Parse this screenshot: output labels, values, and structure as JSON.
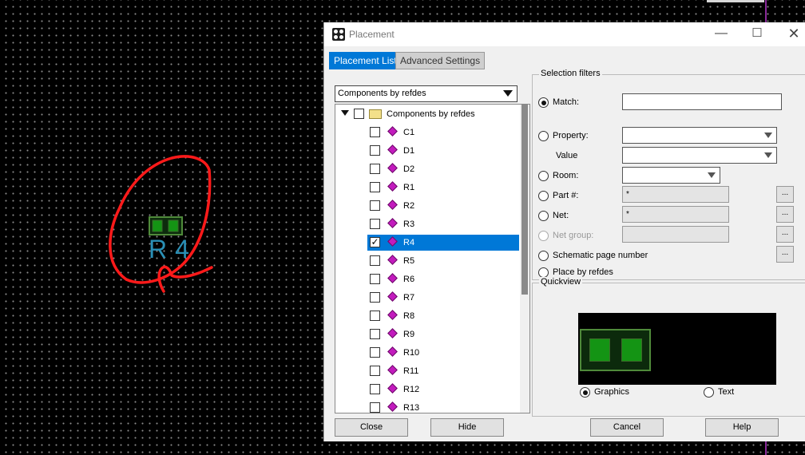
{
  "dialog": {
    "title": "Placement",
    "tabs": [
      {
        "label": "Placement List",
        "active": true
      },
      {
        "label": "Advanced Settings",
        "active": false
      }
    ],
    "list_mode": "Components by refdes",
    "tree": {
      "root_label": "Components by refdes",
      "items": [
        {
          "label": "C1",
          "checked": false,
          "selected": false
        },
        {
          "label": "D1",
          "checked": false,
          "selected": false
        },
        {
          "label": "D2",
          "checked": false,
          "selected": false
        },
        {
          "label": "R1",
          "checked": false,
          "selected": false
        },
        {
          "label": "R2",
          "checked": false,
          "selected": false
        },
        {
          "label": "R3",
          "checked": false,
          "selected": false
        },
        {
          "label": "R4",
          "checked": true,
          "selected": true
        },
        {
          "label": "R5",
          "checked": false,
          "selected": false
        },
        {
          "label": "R6",
          "checked": false,
          "selected": false
        },
        {
          "label": "R7",
          "checked": false,
          "selected": false
        },
        {
          "label": "R8",
          "checked": false,
          "selected": false
        },
        {
          "label": "R9",
          "checked": false,
          "selected": false
        },
        {
          "label": "R10",
          "checked": false,
          "selected": false
        },
        {
          "label": "R11",
          "checked": false,
          "selected": false
        },
        {
          "label": "R12",
          "checked": false,
          "selected": false
        },
        {
          "label": "R13",
          "checked": false,
          "selected": false
        }
      ]
    },
    "filters": {
      "title": "Selection filters",
      "match_label": "Match:",
      "match_value": "",
      "property_label": "Property:",
      "value_label": "Value",
      "room_label": "Room:",
      "part_label": "Part #:",
      "part_value": "*",
      "net_label": "Net:",
      "net_value": "*",
      "netgroup_label": "Net group:",
      "schematic_label": "Schematic page number",
      "place_label": "Place by refdes",
      "ellipsis": "..."
    },
    "quickview": {
      "title": "Quickview",
      "graphics_label": "Graphics",
      "text_label": "Text",
      "selected_mode": "Graphics"
    },
    "buttons": {
      "close": "Close",
      "hide": "Hide",
      "cancel": "Cancel",
      "help": "Help"
    }
  },
  "canvas": {
    "component_refdes": "R4"
  },
  "colors": {
    "accent": "#0078d7",
    "annotation": "#ff1a1a",
    "pad": "#149414",
    "refdes_text": "#2a8fb5"
  }
}
